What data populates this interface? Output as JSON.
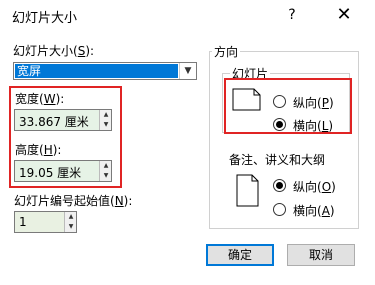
{
  "window": {
    "title": "幻灯片大小",
    "help": "?",
    "close": "✕"
  },
  "left": {
    "slide_size_label": "幻灯片大小(",
    "slide_size_key": "S",
    "slide_size_suffix": "):",
    "slide_size_value": "宽屏",
    "width_label": "宽度(",
    "width_key": "W",
    "width_suffix": "):",
    "width_value": "33.867 厘米",
    "height_label": "高度(",
    "height_key": "H",
    "height_suffix": "):",
    "height_value": "19.05 厘米",
    "start_label": "幻灯片编号起始值(",
    "start_key": "N",
    "start_suffix": "):",
    "start_value": "1"
  },
  "orientation": {
    "group_label": "方向",
    "slides_label": "幻灯片",
    "slides_portrait": "纵向(",
    "slides_portrait_key": "P",
    "slides_landscape": "横向(",
    "slides_landscape_key": "L",
    "slides_selected": "landscape",
    "notes_label": "备注、讲义和大纲",
    "notes_portrait": "纵向(",
    "notes_portrait_key": "O",
    "notes_landscape": "横向(",
    "notes_landscape_key": "A",
    "notes_selected": "portrait",
    "close_paren": ")"
  },
  "buttons": {
    "ok": "确定",
    "cancel": "取消"
  },
  "colors": {
    "highlight": "#e02424",
    "selection": "#0078d7",
    "spin_bg": "#e6f3e6"
  }
}
